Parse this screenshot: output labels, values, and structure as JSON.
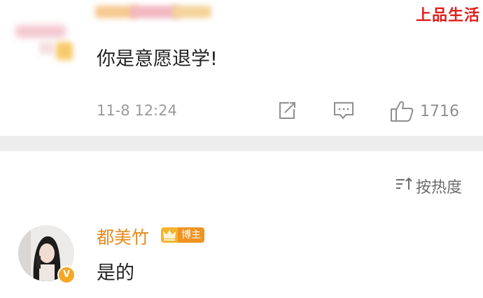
{
  "watermark": "上品生活",
  "comment1": {
    "text": "你是意愿退学!",
    "timestamp": "11-8 12:24",
    "like_count": "1716",
    "icons": {
      "share": "share-icon",
      "reply": "reply-icon",
      "like": "thumbs-up-icon"
    }
  },
  "sort": {
    "label": "按热度",
    "icon": "sort-icon"
  },
  "comment2": {
    "username": "都美竹",
    "badge_label": "博主",
    "text": "是的",
    "verified_badge": "V"
  },
  "colors": {
    "username": "#e78a1e",
    "watermark": "#e0201c",
    "divider": "#ededed"
  }
}
